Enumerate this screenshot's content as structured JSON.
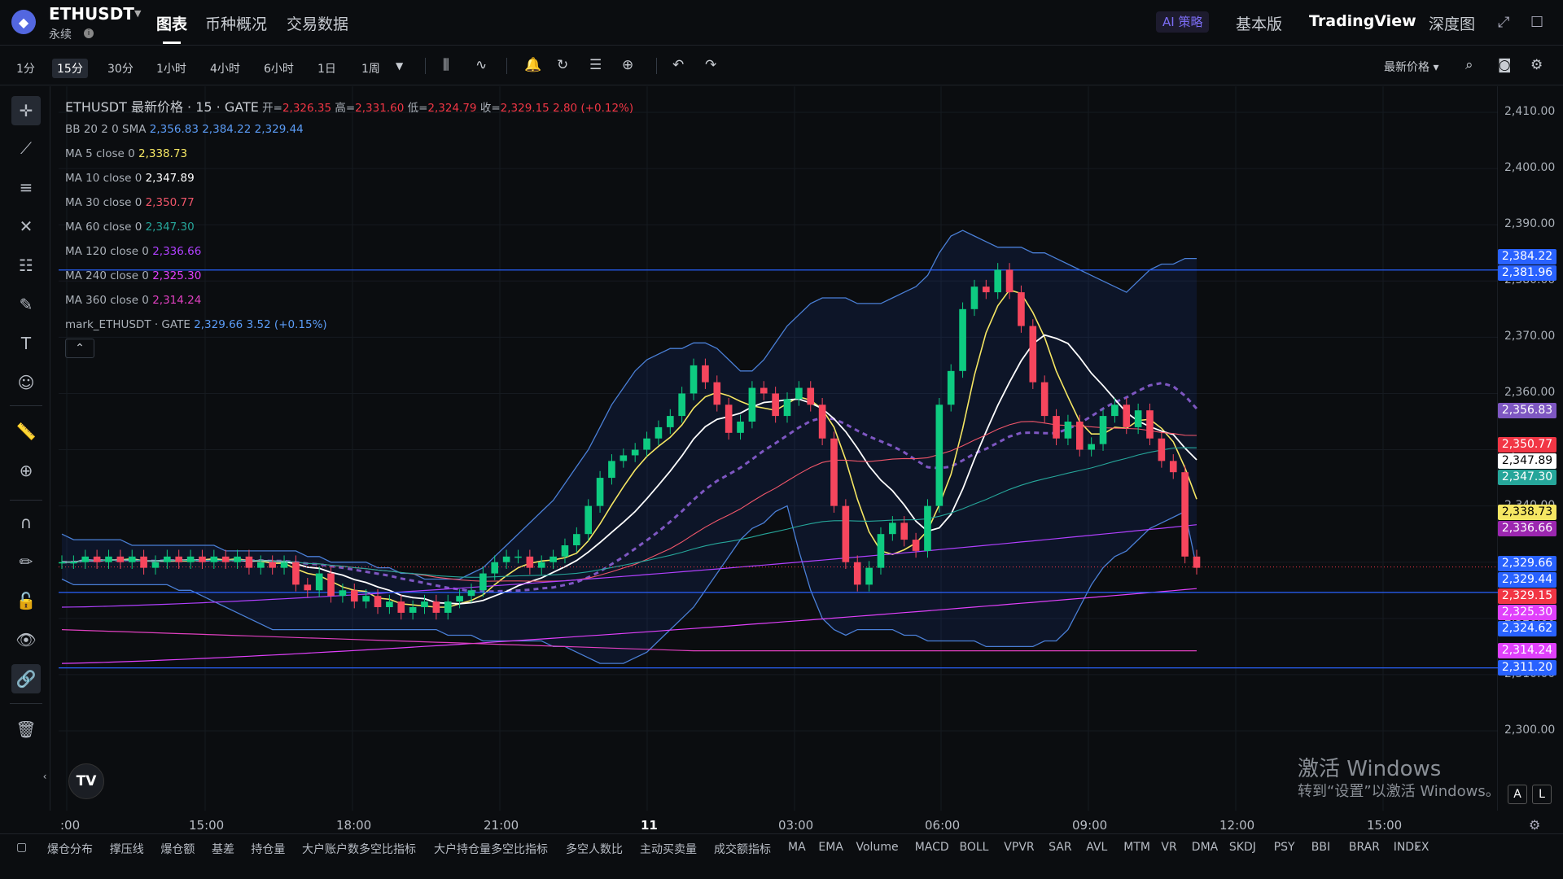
{
  "header": {
    "symbol": "ETHUSDT",
    "contract_type": "永续",
    "nav_tabs": [
      "图表",
      "币种概况",
      "交易数据"
    ],
    "ai_badge": "AI 策略",
    "view_tabs": [
      "基本版",
      "TradingView",
      "深度图"
    ]
  },
  "toolbar": {
    "timeframes": [
      "1分",
      "15分",
      "30分",
      "1小时",
      "4小时",
      "6小时",
      "1日",
      "1周"
    ],
    "active_timeframe": "15分",
    "price_type": "最新价格"
  },
  "legend": {
    "title": "ETHUSDT 最新价格 · 15 · GATE",
    "ohlc": [
      {
        "label": "开=",
        "value": "2,326.35"
      },
      {
        "label": "高=",
        "value": "2,331.60"
      },
      {
        "label": "低=",
        "value": "2,324.79"
      },
      {
        "label": "收=",
        "value": "2,329.15"
      }
    ],
    "change": "2.80 (+0.12%)",
    "indicators": [
      {
        "name": "BB 20 2 0 SMA",
        "values": [
          "2,356.83",
          "2,384.22",
          "2,329.44"
        ],
        "color": "#5b9cf6"
      },
      {
        "name": "MA 5 close 0",
        "values": [
          "2,338.73"
        ],
        "color": "#f5e663"
      },
      {
        "name": "MA 10 close 0",
        "values": [
          "2,347.89"
        ],
        "color": "#ffffff"
      },
      {
        "name": "MA 30 close 0",
        "values": [
          "2,350.77"
        ],
        "color": "#f0566a"
      },
      {
        "name": "MA 60 close 0",
        "values": [
          "2,347.30"
        ],
        "color": "#26a69a"
      },
      {
        "name": "MA 120 close 0",
        "values": [
          "2,336.66"
        ],
        "color": "#b040ff"
      },
      {
        "name": "MA 240 close 0",
        "values": [
          "2,325.30"
        ],
        "color": "#e040fb"
      },
      {
        "name": "MA 360 close 0",
        "values": [
          "2,314.24"
        ],
        "color": "#e040c0"
      },
      {
        "name": "mark_ETHUSDT · GATE",
        "values": [
          "2,329.66",
          "3.52 (+0.15%)"
        ],
        "color": "#5b9cf6"
      }
    ]
  },
  "chart_data": {
    "type": "candlestick",
    "y_axis_labels": [
      "2,410.00",
      "2,400.00",
      "2,390.00",
      "2,380.00",
      "2,370.00",
      "2,360.00",
      "2,350.00",
      "2,340.00",
      "2,330.00",
      "2,320.00",
      "2,310.00",
      "2,300.00"
    ],
    "ylim": [
      2295,
      2413
    ],
    "x_axis_labels": [
      ":00",
      "15:00",
      "18:00",
      "21:00",
      "11",
      "03:00",
      "06:00",
      "09:00",
      "12:00",
      "15:00"
    ],
    "horizontal_lines": [
      2381.96,
      2324.62,
      2311.2
    ],
    "price_tags": [
      {
        "value": "2,384.22",
        "color": "#2962ff"
      },
      {
        "value": "2,381.96",
        "color": "#2962ff"
      },
      {
        "value": "2,356.83",
        "color": "#7e57c2"
      },
      {
        "value": "2,350.77",
        "color": "#f23645"
      },
      {
        "value": "2,347.89",
        "color": "#ffffff"
      },
      {
        "value": "2,347.30",
        "color": "#26a69a"
      },
      {
        "value": "2,338.73",
        "color": "#f5e663"
      },
      {
        "value": "2,336.66",
        "color": "#9c27b0"
      },
      {
        "value": "2,329.66",
        "color": "#2962ff"
      },
      {
        "value": "2,329.44",
        "color": "#2962ff"
      },
      {
        "value": "2,329.15",
        "color": "#f23645"
      },
      {
        "value": "2,325.30",
        "color": "#e040fb"
      },
      {
        "value": "2,324.62",
        "color": "#2962ff"
      },
      {
        "value": "2,314.24",
        "color": "#e040fb"
      },
      {
        "value": "2,311.20",
        "color": "#2962ff"
      }
    ],
    "closes": [
      2330,
      2330,
      2331,
      2330,
      2331,
      2330,
      2331,
      2329,
      2330,
      2331,
      2330,
      2331,
      2330,
      2331,
      2330,
      2331,
      2329,
      2330,
      2329,
      2330,
      2326,
      2325,
      2328,
      2324,
      2325,
      2323,
      2324,
      2322,
      2323,
      2321,
      2322,
      2323,
      2321,
      2323,
      2324,
      2325,
      2328,
      2330,
      2331,
      2331,
      2329,
      2330,
      2331,
      2333,
      2335,
      2340,
      2345,
      2348,
      2349,
      2350,
      2352,
      2354,
      2356,
      2360,
      2365,
      2362,
      2358,
      2353,
      2355,
      2361,
      2360,
      2356,
      2359,
      2361,
      2358,
      2352,
      2340,
      2330,
      2326,
      2329,
      2335,
      2337,
      2334,
      2332,
      2340,
      2358,
      2364,
      2375,
      2379,
      2378,
      2382,
      2378,
      2372,
      2362,
      2356,
      2352,
      2355,
      2350,
      2351,
      2356,
      2358,
      2354,
      2357,
      2352,
      2348,
      2346,
      2331,
      2329
    ],
    "bb_upper": [
      2335,
      2334,
      2334,
      2334,
      2334,
      2334,
      2333,
      2333,
      2333,
      2333,
      2333,
      2333,
      2333,
      2333,
      2332,
      2332,
      2332,
      2332,
      2332,
      2332,
      2332,
      2331,
      2331,
      2330,
      2330,
      2330,
      2330,
      2329,
      2329,
      2328,
      2328,
      2327,
      2327,
      2327,
      2327,
      2328,
      2329,
      2331,
      2333,
      2335,
      2337,
      2339,
      2341,
      2344,
      2347,
      2350,
      2354,
      2358,
      2361,
      2364,
      2366,
      2367,
      2368,
      2368,
      2369,
      2369,
      2368,
      2366,
      2364,
      2364,
      2366,
      2369,
      2372,
      2374,
      2376,
      2377,
      2377,
      2377,
      2376,
      2376,
      2376,
      2377,
      2378,
      2379,
      2381,
      2385,
      2388,
      2389,
      2388,
      2387,
      2386,
      2386,
      2386,
      2385,
      2385,
      2384,
      2383,
      2382,
      2381,
      2380,
      2379,
      2378,
      2380,
      2382,
      2383,
      2383,
      2384,
      2384
    ],
    "bb_lower": [
      2327,
      2326,
      2326,
      2326,
      2326,
      2326,
      2326,
      2326,
      2326,
      2326,
      2325,
      2325,
      2324,
      2323,
      2322,
      2321,
      2320,
      2319,
      2318,
      2318,
      2318,
      2318,
      2318,
      2318,
      2318,
      2318,
      2318,
      2318,
      2318,
      2318,
      2318,
      2318,
      2318,
      2317,
      2317,
      2317,
      2316,
      2316,
      2316,
      2316,
      2316,
      2316,
      2315,
      2315,
      2314,
      2313,
      2312,
      2312,
      2312,
      2313,
      2314,
      2316,
      2318,
      2320,
      2322,
      2325,
      2328,
      2331,
      2334,
      2336,
      2337,
      2339,
      2340,
      2332,
      2325,
      2320,
      2318,
      2317,
      2318,
      2318,
      2318,
      2318,
      2317,
      2317,
      2316,
      2316,
      2316,
      2316,
      2316,
      2315,
      2315,
      2315,
      2315,
      2315,
      2316,
      2316,
      2318,
      2322,
      2326,
      2329,
      2331,
      2332,
      2334,
      2336,
      2337,
      2338,
      2339,
      2329
    ]
  },
  "watermark": {
    "line1": "激活 Windows",
    "line2": "转到“设置”以激活 Windows。"
  },
  "chart_corner": {
    "tv_logo": "TV",
    "a_button": "A",
    "l_button": "L"
  },
  "bottom_indicators": [
    "爆仓分布",
    "撑压线",
    "爆仓额",
    "基差",
    "持仓量",
    "大户账户数多空比指标",
    "大户持仓量多空比指标",
    "多空人数比",
    "主动买卖量",
    "成交额指标",
    "MA",
    "EMA",
    "Volume",
    "MACD",
    "BOLL",
    "VPVR",
    "SAR",
    "AVL",
    "MTM",
    "VR",
    "DMA",
    "SKDJ",
    "PSY",
    "BBI",
    "BRAR",
    "INDEX"
  ]
}
